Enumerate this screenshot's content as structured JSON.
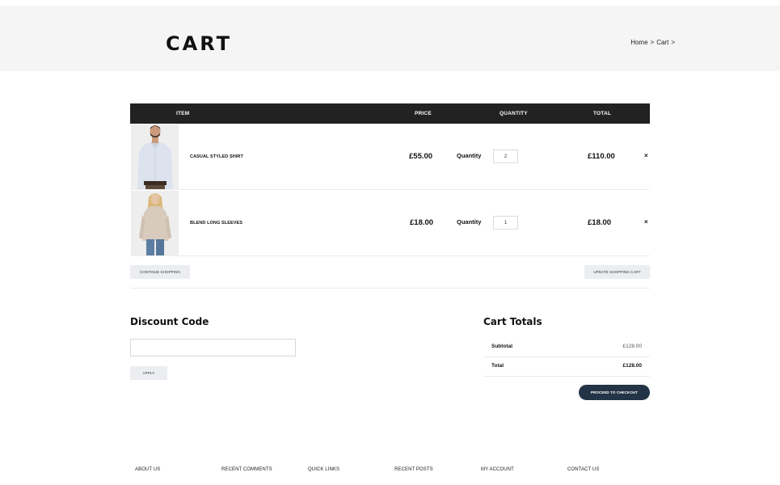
{
  "header": {
    "title": "CART",
    "breadcrumb": [
      "Home",
      ">",
      "Cart",
      ">"
    ]
  },
  "table": {
    "columns": {
      "item": "ITEM",
      "price": "PRICE",
      "quantity": "QUANTITY",
      "total": "TOTAL"
    },
    "rows": [
      {
        "name": "CASUAL STYLED SHIRT",
        "price": "£55.00",
        "qty_label": "Quantity",
        "qty": "2",
        "total": "£110.00",
        "remove": "×"
      },
      {
        "name": "BLEND LONG SLEEVES",
        "price": "£18.00",
        "qty_label": "Quantity",
        "qty": "1",
        "total": "£18.00",
        "remove": "×"
      }
    ]
  },
  "actions": {
    "continue": "CONTINUE SHOPPING",
    "update": "UPDATE SHOPPING CART"
  },
  "discount": {
    "title": "Discount Code",
    "placeholder": "",
    "apply": "APPLY"
  },
  "totals": {
    "title": "Cart Totals",
    "subtotal_label": "Subtotal",
    "subtotal_value": "£128.00",
    "total_label": "Total",
    "total_value": "£128.00",
    "checkout": "PROCEED TO CHECKOUT"
  },
  "footer": [
    "ABOUT US",
    "RECENT COMMENTS",
    "QUICK LINKS",
    "RECENT POSTS",
    "MY ACCOUNT",
    "CONTACT US"
  ],
  "colors": {
    "header_bg": "#f5f5f5",
    "table_head": "#222222",
    "checkout": "#233446"
  },
  "icons": [
    "remove-icon",
    "shirt-product-image",
    "sweater-product-image"
  ]
}
